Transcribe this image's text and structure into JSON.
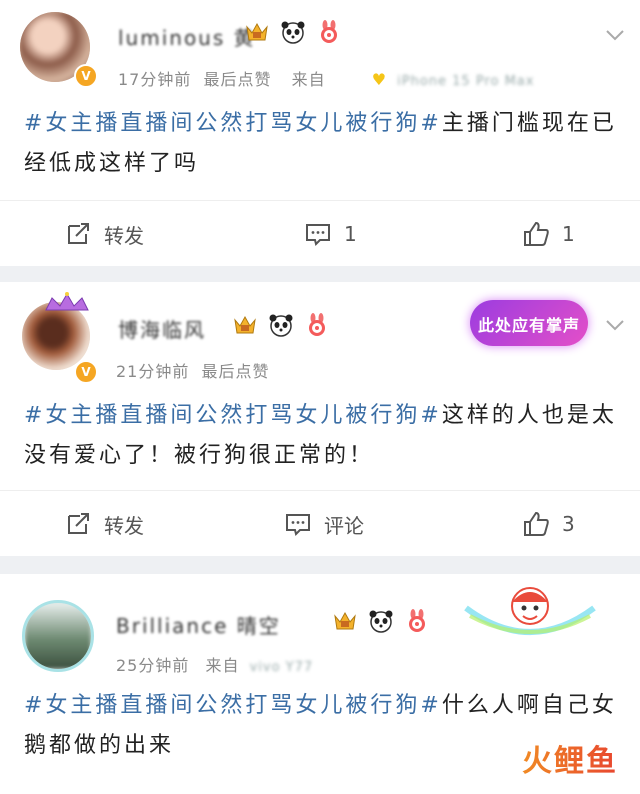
{
  "posts": [
    {
      "username": "luminous 黄",
      "meta_time": "17分钟前",
      "meta_last": "最后点赞",
      "meta_from_label": "来自",
      "meta_device": "iPhone 15 Pro Max",
      "text_tag": "#女主播直播间公然打骂女儿被行狗#",
      "text_body": "主播门槛现在已经低成这样了吗",
      "repost_label": "转发",
      "comment_label": "1",
      "like_label": "1"
    },
    {
      "username": "博海临风",
      "meta_time": "21分钟前",
      "meta_last": "最后点赞",
      "sticker_text": "此处应有掌声",
      "text_tag": "#女主播直播间公然打骂女儿被行狗#",
      "text_body": "这样的人也是太没有爱心了！被行狗很正常的！",
      "repost_label": "转发",
      "comment_label": "评论",
      "like_label": "3"
    },
    {
      "username": "Brilliance 晴空",
      "meta_time": "25分钟前",
      "meta_from_label": "来自",
      "meta_device": "vivo Y77",
      "text_tag": "#女主播直播间公然打骂女儿被行狗#",
      "text_body": "什么人啊自己女鹅都做的出来"
    }
  ],
  "brand": {
    "text": "火鲤鱼",
    "color_a": "#f08a24",
    "color_b": "#e8462f"
  },
  "colors": {
    "tag": "#3b6ea5",
    "meta": "#8a8a8a",
    "badge": "#f5a623"
  }
}
